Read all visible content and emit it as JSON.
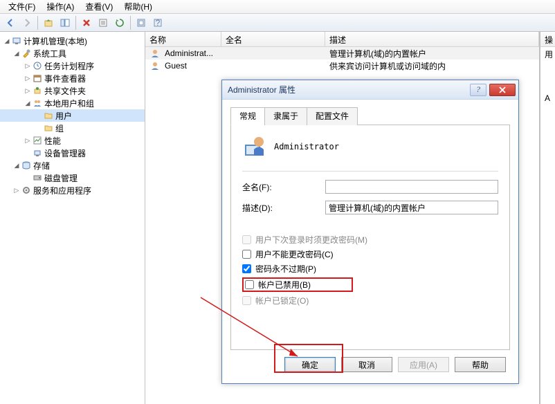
{
  "menu": {
    "file": "文件(F)",
    "action": "操作(A)",
    "view": "查看(V)",
    "help": "帮助(H)"
  },
  "tree": {
    "root": "计算机管理(本地)",
    "system_tools": "系统工具",
    "task_scheduler": "任务计划程序",
    "event_viewer": "事件查看器",
    "shared_folders": "共享文件夹",
    "local_users": "本地用户和组",
    "users": "用户",
    "groups": "组",
    "performance": "性能",
    "device_manager": "设备管理器",
    "storage": "存储",
    "disk_mgmt": "磁盘管理",
    "services": "服务和应用程序"
  },
  "list": {
    "col_name": "名称",
    "col_full": "全名",
    "col_desc": "描述",
    "rows": [
      {
        "name": "Administrat...",
        "full": "",
        "desc": "管理计算机(域)的内置帐户"
      },
      {
        "name": "Guest",
        "full": "",
        "desc": "供来宾访问计算机或访问域的内"
      }
    ]
  },
  "actions": {
    "header": "操",
    "item1": "用",
    "item2": "A"
  },
  "dialog": {
    "title": "Administrator 属性",
    "tabs": {
      "general": "常规",
      "member": "隶属于",
      "profile": "配置文件"
    },
    "username": "Administrator",
    "fullname_label": "全名(F):",
    "fullname_value": "",
    "desc_label": "描述(D):",
    "desc_value": "管理计算机(域)的内置帐户",
    "chk_mustchange": "用户下次登录时须更改密码(M)",
    "chk_cannotchange": "用户不能更改密码(C)",
    "chk_neverexpire": "密码永不过期(P)",
    "chk_disabled": "帐户已禁用(B)",
    "chk_locked": "帐户已锁定(O)",
    "btn_ok": "确定",
    "btn_cancel": "取消",
    "btn_apply": "应用(A)",
    "btn_help": "帮助"
  }
}
